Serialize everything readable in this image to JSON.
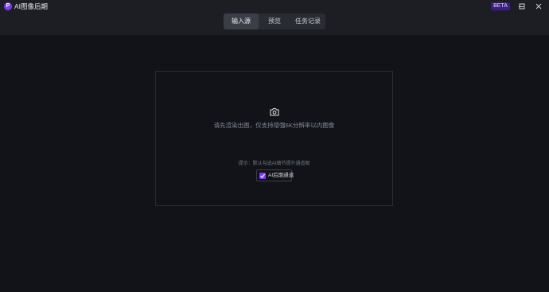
{
  "app": {
    "title": "AI图像后期",
    "logo_letter": "P",
    "accent_color": "#7b3ff2",
    "background_color": "#111318"
  },
  "tabs": [
    {
      "label": "输入源",
      "active": true
    },
    {
      "label": "预览",
      "active": false
    },
    {
      "label": "任务记录",
      "active": false
    }
  ],
  "badge": {
    "label": "BETA"
  },
  "window_controls": {
    "minimize_icon": "minimize-icon",
    "maximize_icon": "maximize-icon",
    "close_icon": "close-icon"
  },
  "main": {
    "upload_icon": "camera-icon",
    "hint": "请先渲染出图，仅支持增强6K分辨率以内图像",
    "tip": "提示：默认勾选AI细节提升通道图",
    "checkbox": {
      "label": "AI后期通道",
      "checked": true
    }
  }
}
